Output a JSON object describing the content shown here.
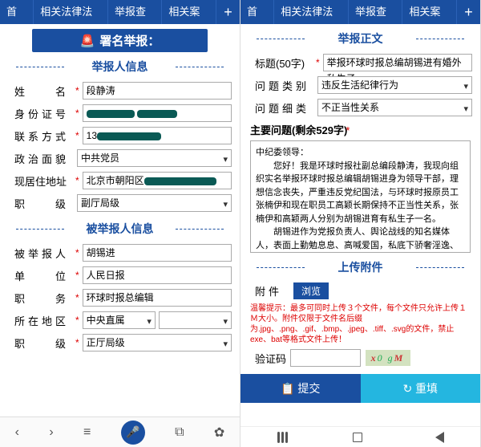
{
  "tabs": {
    "home": "首页",
    "laws": "相关法律法规",
    "query": "举报查询",
    "cases": "相关案例"
  },
  "banner": "署名举报：",
  "sections": {
    "reporter": "举报人信息",
    "reported": "被举报人信息",
    "body": "举报正文",
    "attach": "上传附件"
  },
  "labels": {
    "name": "姓　　名",
    "idno": "身份证号",
    "contact": "联系方式",
    "polit": "政治面貌",
    "addr": "现居住地址",
    "rank": "职　　级",
    "reported": "被举报人",
    "unit": "单　　位",
    "duty": "职　　务",
    "region": "所在地区",
    "title": "标题(50字)",
    "cat": "问题类别",
    "subcat": "问题细类",
    "main": "主要问题(剩余529字)",
    "attach": "附件",
    "captcha": "验证码"
  },
  "values": {
    "name": "段静涛",
    "contact_prefix": "13",
    "polit": "中共党员",
    "addr_prefix": "北京市朝阳区",
    "rank": "副厅局级",
    "reported": "胡锡进",
    "unit": "人民日报",
    "duty": "环球时报总编辑",
    "region": "中央直属",
    "rank2": "正厅局级",
    "title": "举报环球时报总编胡锡进有婚外私生子",
    "cat": "违反生活纪律行为",
    "subcat": "不正当性关系",
    "body_p1": "中纪委领导：",
    "body_p2": "　　您好！我是环球时报社副总编段静涛，我现向组织实名举报环球时报总编辑胡锡进身为领导干部，理想信念丧失，严重违反党纪国法，与环球时报原员工张楠伊和现在职员工高颖长期保持不正当性关系，张楠伊和高颖两人分别为胡锡进育有私生子一名。",
    "body_p3": "　　胡锡进作为党报负责人、舆论战线的知名媒体人，表面上勤勉息息、高喊爱国，私底下骄奢淫逸、腐化堕落。",
    "browse": "浏览",
    "captcha": "x0 gM"
  },
  "hint": "温馨提示：最多可同时上传３个文件，每个文件只允许上传１Ｍ大小。附件仅限于文件名后缀为.jpg、.png、.gif、.bmp、.jpeg、.tiff、.svg的文件，禁止exe、bat等格式文件上传！",
  "buttons": {
    "submit": "提交",
    "reset": "重填"
  }
}
